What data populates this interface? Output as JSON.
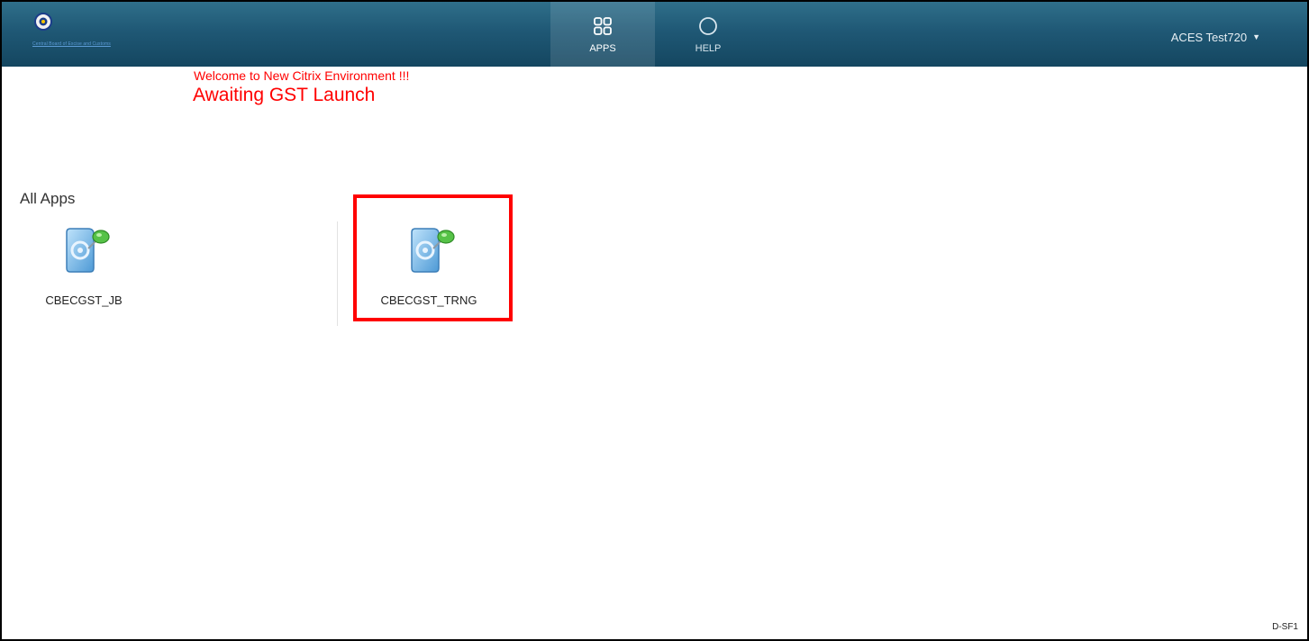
{
  "header": {
    "logo_text": "Central Board of Excise and Customs",
    "tabs": [
      {
        "label": "APPS",
        "icon": "apps-grid-icon",
        "active": true
      },
      {
        "label": "HELP",
        "icon": "help-circle-icon",
        "active": false
      }
    ],
    "user_name": "ACES Test720",
    "user_caret": "▼"
  },
  "banner": {
    "welcome": "Welcome to New Citrix Environment !!!",
    "status": "Awaiting GST Launch"
  },
  "apps_section": {
    "title": "All Apps",
    "apps": [
      {
        "name": "CBECGST_JB",
        "icon": "app-pushpin-icon"
      },
      {
        "name": "CBECGST_TRNG",
        "icon": "app-pushpin-icon"
      }
    ]
  },
  "footer": {
    "code": "D-SF1"
  },
  "colors": {
    "header_bg": "#1f5875",
    "banner_text": "#ff0000",
    "highlight_border": "#ff0000"
  }
}
